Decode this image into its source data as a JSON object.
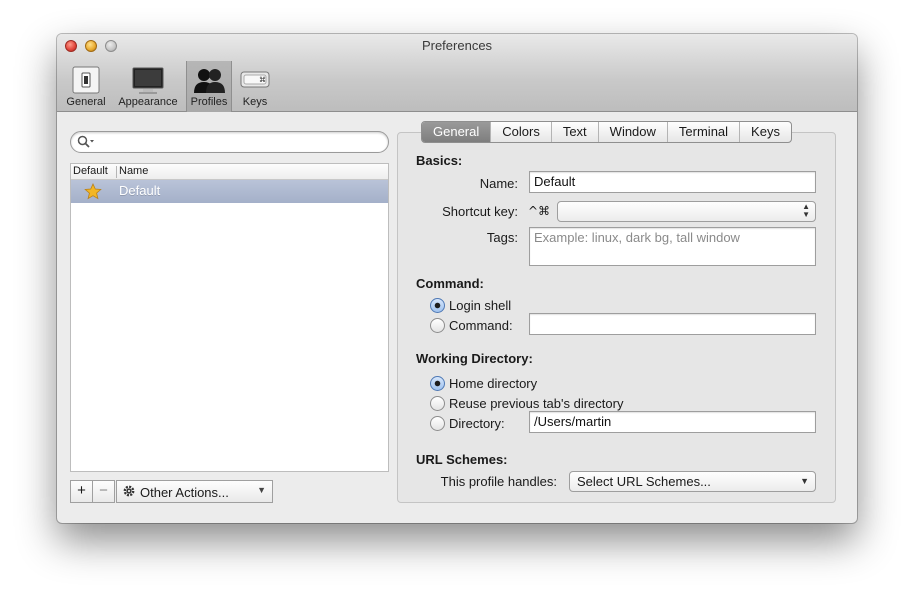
{
  "window": {
    "title": "Preferences"
  },
  "toolbar": {
    "items": [
      {
        "label": "General",
        "icon": "switch-icon"
      },
      {
        "label": "Appearance",
        "icon": "monitor-icon"
      },
      {
        "label": "Profiles",
        "icon": "users-icon"
      },
      {
        "label": "Keys",
        "icon": "keyboard-icon"
      }
    ],
    "selected": "Profiles"
  },
  "profiles_list": {
    "search_placeholder": "",
    "columns": [
      "Default",
      "Name"
    ],
    "rows": [
      {
        "default": true,
        "name": "Default"
      }
    ],
    "buttons": {
      "add": "+",
      "remove": "−",
      "other_actions": "Other Actions..."
    }
  },
  "tabs": {
    "items": [
      "General",
      "Colors",
      "Text",
      "Window",
      "Terminal",
      "Keys"
    ],
    "active": "General"
  },
  "basics": {
    "title": "Basics:",
    "name_label": "Name:",
    "name_value": "Default",
    "shortcut_label": "Shortcut key:",
    "shortcut_prefix": "^⌘",
    "shortcut_value": "",
    "tags_label": "Tags:",
    "tags_placeholder": "Example: linux, dark bg, tall window"
  },
  "command": {
    "title": "Command:",
    "login_shell_label": "Login shell",
    "command_label": "Command:",
    "command_value": "",
    "selected": "Login shell"
  },
  "working_directory": {
    "title": "Working Directory:",
    "home_label": "Home directory",
    "reuse_label": "Reuse previous tab's directory",
    "directory_label": "Directory:",
    "directory_value": "/Users/martin",
    "selected": "Home directory"
  },
  "url_schemes": {
    "title": "URL Schemes:",
    "handles_label": "This profile handles:",
    "select_value": "Select URL Schemes..."
  },
  "colors": {
    "selection_row": "#a9b4cc",
    "active_tab": "#8a8a8a",
    "radio_on": "#9fc2ef"
  }
}
